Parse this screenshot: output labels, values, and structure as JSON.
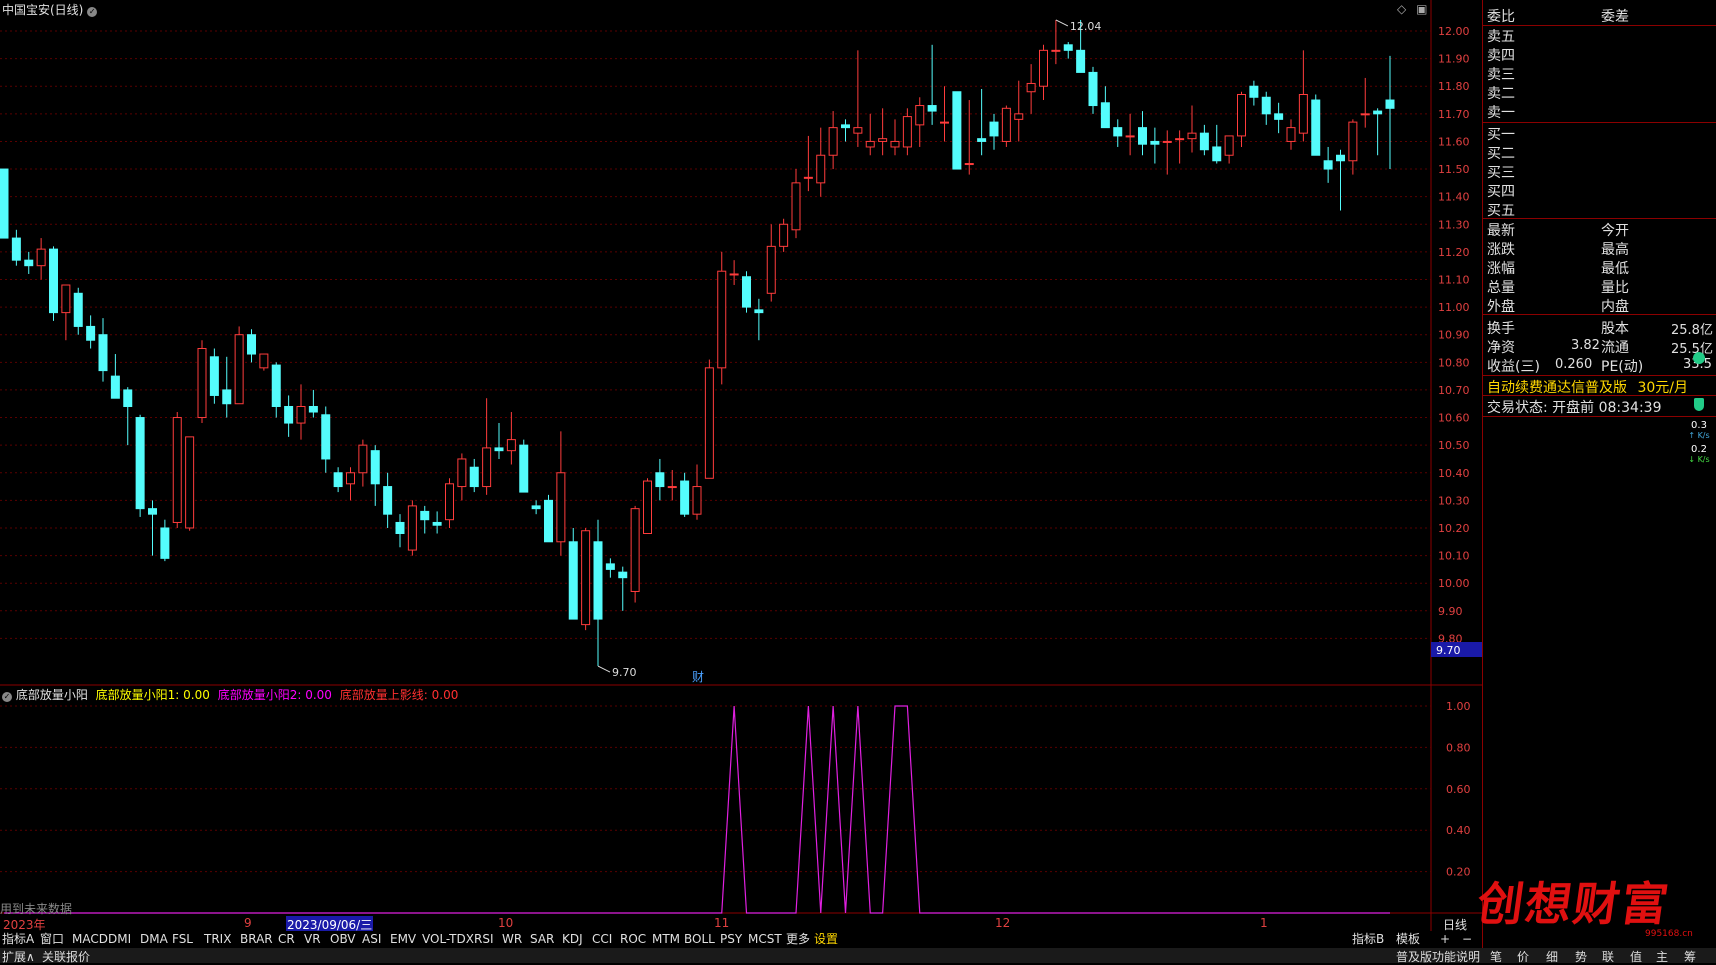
{
  "title": "中国宝安(日线)",
  "price_axis": [
    "12.00",
    "11.90",
    "11.80",
    "11.70",
    "11.60",
    "11.50",
    "11.40",
    "11.30",
    "11.20",
    "11.10",
    "11.00",
    "10.90",
    "10.80",
    "10.70",
    "10.60",
    "10.50",
    "10.40",
    "10.30",
    "10.20",
    "10.10",
    "10.00",
    "9.90",
    "9.80"
  ],
  "high_label": "12.04",
  "low_label": "9.70",
  "current_price_tag": "9.70",
  "event_marker": "财",
  "indicator": {
    "name": "底部放量小阳",
    "line1": "底部放量小阳1: 0.00",
    "line2": "底部放量小阳2: 0.00",
    "line3": "底部放量上影线: 0.00",
    "axis": [
      "1.00",
      "0.80",
      "0.60",
      "0.40",
      "0.20"
    ],
    "footnote": "用到未来数据",
    "colors": {
      "line1": "#ffff00",
      "line2": "#ff00ff",
      "line3": "#ff3030"
    }
  },
  "date_axis": {
    "year": "2023年",
    "m9": "9",
    "cursor_date": "2023/09/06/三",
    "m10": "10",
    "m11": "11",
    "m12": "12",
    "m1": "1",
    "period": "日线"
  },
  "tabs": [
    "指标A",
    "窗口",
    "MACD",
    "DMI",
    "DMA",
    "FSL",
    "TRIX",
    "BRAR",
    "CR",
    "VR",
    "OBV",
    "ASI",
    "EMV",
    "VOL-TDX",
    "RSI",
    "WR",
    "SAR",
    "KDJ",
    "CCI",
    "ROC",
    "MTM",
    "BOLL",
    "PSY",
    "MCST",
    "更多",
    "设置"
  ],
  "tabs_right": [
    "指标B",
    "模板",
    "+",
    "−"
  ],
  "status_left": [
    "扩展∧",
    "关联报价"
  ],
  "status_right": [
    "普及版功能说明",
    "笔",
    "价",
    "细",
    "势",
    "联",
    "值",
    "主",
    "筹"
  ],
  "right_panel": {
    "order_header": [
      "委比",
      "委差"
    ],
    "sells": [
      "卖五",
      "卖四",
      "卖三",
      "卖二",
      "卖一"
    ],
    "buys": [
      "买一",
      "买二",
      "买三",
      "买四",
      "买五"
    ],
    "quote_left": [
      "最新",
      "涨跌",
      "涨幅",
      "总量",
      "外盘"
    ],
    "quote_right": [
      "今开",
      "最高",
      "最低",
      "量比",
      "内盘"
    ],
    "fin": [
      {
        "l": "换手",
        "m": "股本",
        "v": "25.8亿"
      },
      {
        "l": "净资",
        "lv": "3.82",
        "m": "流通",
        "v": "25.5亿"
      },
      {
        "l": "收益(三)",
        "lv": "0.260",
        "m": "PE(动)",
        "v": "33.5"
      }
    ],
    "promo": "自动续费通达信普及版",
    "promo_price": "30元/月",
    "trade_state": "交易状态: 开盘前 08:34:39",
    "speed1": "0.3",
    "speed2": "0.2",
    "speed_unit": "K/s"
  },
  "watermark": "创想财富",
  "watermark_url": "995168.cn",
  "chart_data": {
    "type": "candlestick",
    "ylim": [
      9.75,
      12.08
    ],
    "candles": [
      [
        11.5,
        11.5,
        11.25,
        11.25
      ],
      [
        11.25,
        11.28,
        11.15,
        11.17
      ],
      [
        11.17,
        11.2,
        11.12,
        11.15
      ],
      [
        11.15,
        11.25,
        11.1,
        11.21
      ],
      [
        11.21,
        11.22,
        10.95,
        10.98
      ],
      [
        10.98,
        11.08,
        10.88,
        11.08
      ],
      [
        11.05,
        11.07,
        10.9,
        10.93
      ],
      [
        10.93,
        10.97,
        10.85,
        10.88
      ],
      [
        10.9,
        10.96,
        10.73,
        10.77
      ],
      [
        10.75,
        10.83,
        10.72,
        10.67
      ],
      [
        10.7,
        10.71,
        10.5,
        10.64
      ],
      [
        10.6,
        10.61,
        10.24,
        10.27
      ],
      [
        10.27,
        10.3,
        10.1,
        10.25
      ],
      [
        10.2,
        10.23,
        10.08,
        10.09
      ],
      [
        10.22,
        10.62,
        10.2,
        10.6
      ],
      [
        10.2,
        10.53,
        10.19,
        10.53
      ],
      [
        10.6,
        10.88,
        10.58,
        10.85
      ],
      [
        10.82,
        10.85,
        10.65,
        10.68
      ],
      [
        10.7,
        10.82,
        10.6,
        10.65
      ],
      [
        10.65,
        10.93,
        10.65,
        10.9
      ],
      [
        10.9,
        10.92,
        10.8,
        10.83
      ],
      [
        10.78,
        10.83,
        10.77,
        10.83
      ],
      [
        10.79,
        10.8,
        10.6,
        10.64
      ],
      [
        10.64,
        10.68,
        10.53,
        10.58
      ],
      [
        10.58,
        10.72,
        10.52,
        10.64
      ],
      [
        10.64,
        10.7,
        10.6,
        10.62
      ],
      [
        10.61,
        10.64,
        10.4,
        10.45
      ],
      [
        10.4,
        10.42,
        10.33,
        10.35
      ],
      [
        10.36,
        10.42,
        10.3,
        10.4
      ],
      [
        10.4,
        10.52,
        10.35,
        10.5
      ],
      [
        10.48,
        10.5,
        10.28,
        10.36
      ],
      [
        10.35,
        10.4,
        10.2,
        10.25
      ],
      [
        10.22,
        10.25,
        10.13,
        10.18
      ],
      [
        10.12,
        10.3,
        10.1,
        10.28
      ],
      [
        10.26,
        10.28,
        10.18,
        10.23
      ],
      [
        10.22,
        10.26,
        10.18,
        10.21
      ],
      [
        10.23,
        10.38,
        10.2,
        10.36
      ],
      [
        10.35,
        10.47,
        10.3,
        10.45
      ],
      [
        10.42,
        10.45,
        10.33,
        10.35
      ],
      [
        10.35,
        10.67,
        10.32,
        10.49
      ],
      [
        10.49,
        10.58,
        10.45,
        10.48
      ],
      [
        10.48,
        10.62,
        10.43,
        10.52
      ],
      [
        10.5,
        10.52,
        10.33,
        10.33
      ],
      [
        10.28,
        10.3,
        10.25,
        10.27
      ],
      [
        10.3,
        10.32,
        10.15,
        10.15
      ],
      [
        10.15,
        10.55,
        10.1,
        10.4
      ],
      [
        10.15,
        10.2,
        9.87,
        9.87
      ],
      [
        9.85,
        10.2,
        9.83,
        10.19
      ],
      [
        10.15,
        10.23,
        9.7,
        9.87
      ],
      [
        10.07,
        10.09,
        10.02,
        10.05
      ],
      [
        10.04,
        10.06,
        9.9,
        10.02
      ],
      [
        9.97,
        10.28,
        9.93,
        10.27
      ],
      [
        10.18,
        10.38,
        10.18,
        10.37
      ],
      [
        10.4,
        10.45,
        10.3,
        10.35
      ],
      [
        10.35,
        10.41,
        10.3,
        10.35
      ],
      [
        10.37,
        10.4,
        10.24,
        10.25
      ],
      [
        10.25,
        10.43,
        10.23,
        10.35
      ],
      [
        10.38,
        10.81,
        10.38,
        10.78
      ],
      [
        10.78,
        11.2,
        10.72,
        11.13
      ],
      [
        11.12,
        11.17,
        11.08,
        11.12
      ],
      [
        11.11,
        11.13,
        10.98,
        11.0
      ],
      [
        10.99,
        11.03,
        10.88,
        10.98
      ],
      [
        11.05,
        11.3,
        11.02,
        11.22
      ],
      [
        11.22,
        11.32,
        11.2,
        11.3
      ],
      [
        11.28,
        11.5,
        11.25,
        11.45
      ],
      [
        11.47,
        11.62,
        11.42,
        11.47
      ],
      [
        11.45,
        11.65,
        11.4,
        11.55
      ],
      [
        11.55,
        11.71,
        11.5,
        11.65
      ],
      [
        11.66,
        11.68,
        11.6,
        11.65
      ],
      [
        11.63,
        11.93,
        11.58,
        11.65
      ],
      [
        11.58,
        11.7,
        11.55,
        11.6
      ],
      [
        11.6,
        11.72,
        11.55,
        11.61
      ],
      [
        11.58,
        11.68,
        11.55,
        11.6
      ],
      [
        11.58,
        11.72,
        11.55,
        11.69
      ],
      [
        11.66,
        11.76,
        11.58,
        11.73
      ],
      [
        11.73,
        11.95,
        11.66,
        11.71
      ],
      [
        11.67,
        11.8,
        11.6,
        11.67
      ],
      [
        11.78,
        11.78,
        11.5,
        11.5
      ],
      [
        11.52,
        11.75,
        11.48,
        11.52
      ],
      [
        11.61,
        11.79,
        11.55,
        11.6
      ],
      [
        11.67,
        11.7,
        11.57,
        11.62
      ],
      [
        11.6,
        11.73,
        11.58,
        11.72
      ],
      [
        11.68,
        11.82,
        11.6,
        11.7
      ],
      [
        11.78,
        11.88,
        11.7,
        11.81
      ],
      [
        11.8,
        11.95,
        11.75,
        11.93
      ],
      [
        11.93,
        12.04,
        11.88,
        11.93
      ],
      [
        11.95,
        11.96,
        11.9,
        11.93
      ],
      [
        11.93,
        12.04,
        11.85,
        11.85
      ],
      [
        11.85,
        11.87,
        11.7,
        11.73
      ],
      [
        11.74,
        11.8,
        11.65,
        11.65
      ],
      [
        11.65,
        11.68,
        11.58,
        11.62
      ],
      [
        11.62,
        11.7,
        11.55,
        11.62
      ],
      [
        11.65,
        11.71,
        11.55,
        11.59
      ],
      [
        11.6,
        11.65,
        11.52,
        11.59
      ],
      [
        11.6,
        11.64,
        11.48,
        11.6
      ],
      [
        11.61,
        11.64,
        11.52,
        11.61
      ],
      [
        11.61,
        11.73,
        11.56,
        11.63
      ],
      [
        11.63,
        11.66,
        11.55,
        11.57
      ],
      [
        11.58,
        11.66,
        11.52,
        11.53
      ],
      [
        11.55,
        11.62,
        11.52,
        11.62
      ],
      [
        11.62,
        11.78,
        11.58,
        11.77
      ],
      [
        11.8,
        11.82,
        11.73,
        11.76
      ],
      [
        11.76,
        11.78,
        11.66,
        11.7
      ],
      [
        11.7,
        11.74,
        11.63,
        11.68
      ],
      [
        11.6,
        11.68,
        11.57,
        11.65
      ],
      [
        11.63,
        11.93,
        11.6,
        11.77
      ],
      [
        11.75,
        11.77,
        11.55,
        11.55
      ],
      [
        11.53,
        11.58,
        11.45,
        11.5
      ],
      [
        11.55,
        11.57,
        11.35,
        11.53
      ],
      [
        11.53,
        11.68,
        11.48,
        11.67
      ],
      [
        11.7,
        11.83,
        11.65,
        11.7
      ],
      [
        11.71,
        11.72,
        11.55,
        11.7
      ],
      [
        11.75,
        11.91,
        11.5,
        11.72
      ]
    ],
    "signal_line": [
      0,
      0,
      0,
      0,
      0,
      0,
      0,
      0,
      0,
      0,
      0,
      0,
      0,
      0,
      0,
      0,
      0,
      0,
      0,
      0,
      0,
      0,
      0,
      0,
      0,
      0,
      0,
      0,
      0,
      0,
      0,
      0,
      0,
      0,
      0,
      0,
      0,
      0,
      0,
      0,
      0,
      0,
      0,
      0,
      0,
      0,
      0,
      0,
      0,
      0,
      0,
      0,
      0,
      0,
      0,
      0,
      0,
      0,
      0,
      1,
      0,
      0,
      0,
      0,
      0,
      1,
      0,
      1,
      0,
      1,
      0,
      0,
      1,
      1,
      0,
      0,
      0,
      0,
      0,
      0,
      0,
      0,
      0,
      0,
      0,
      0,
      0,
      0,
      0,
      0,
      0,
      0,
      0,
      0,
      0,
      0,
      0,
      0,
      0,
      0,
      0,
      0,
      0,
      0,
      0,
      0,
      0,
      0,
      0,
      0,
      0,
      0,
      0
    ]
  }
}
